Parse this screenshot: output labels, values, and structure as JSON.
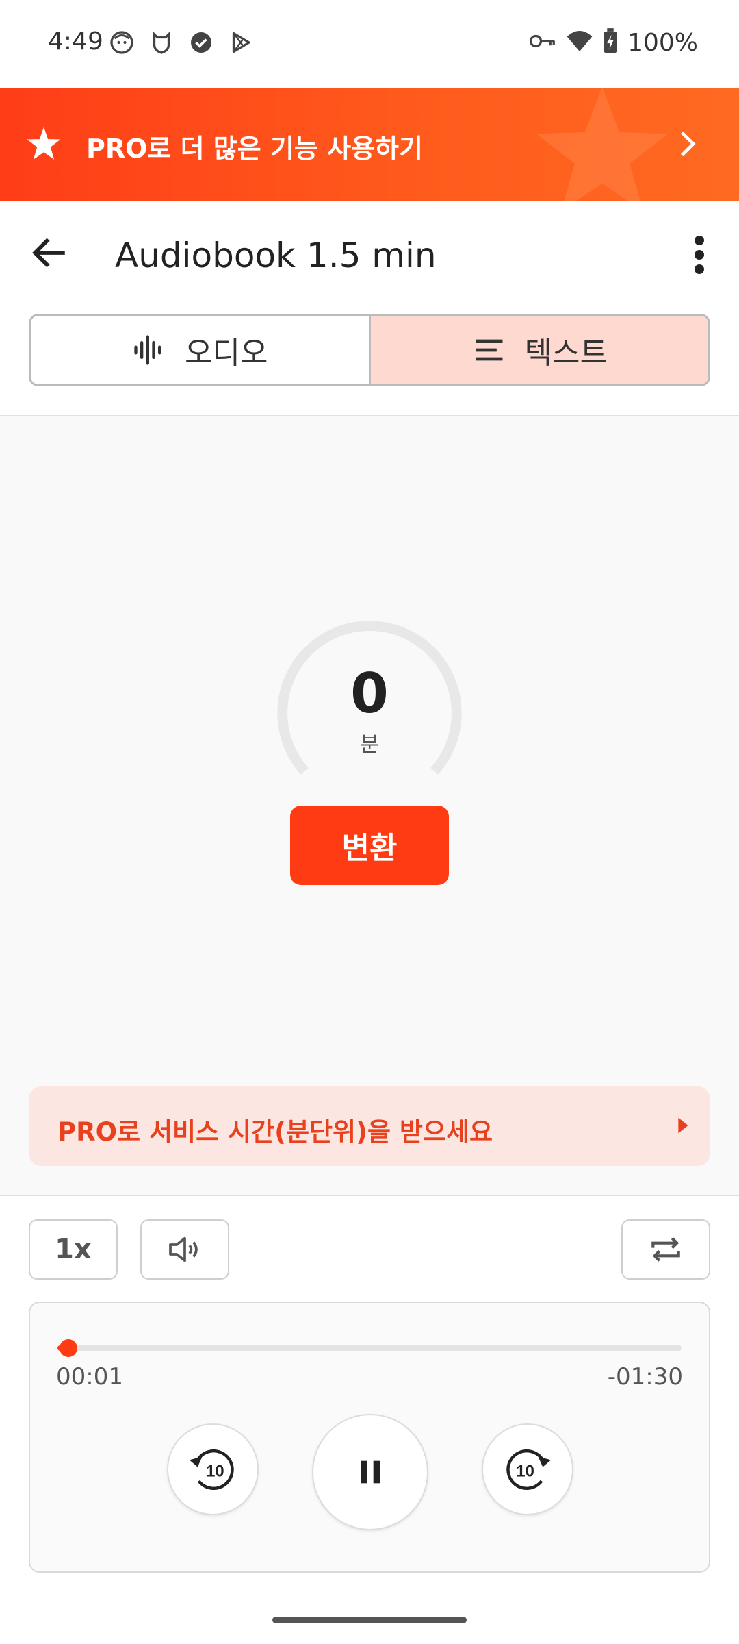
{
  "status_bar": {
    "time": "4:49",
    "battery": "100%",
    "icons_left": [
      "face-icon",
      "shield-cat-icon",
      "badge-check-icon",
      "play-store-icon"
    ],
    "icons_right": [
      "key-icon",
      "wifi-icon",
      "battery-charging-icon"
    ]
  },
  "promo": {
    "text": "PRO로 더 많은 기능 사용하기",
    "star_icon": "star-icon",
    "chevron_icon": "chevron-right-icon"
  },
  "appbar": {
    "title": "Audiobook 1.5 min",
    "back_icon": "arrow-back-icon",
    "more_icon": "more-vert-icon"
  },
  "tabs": [
    {
      "label": "오디오",
      "icon": "waveform-icon",
      "active": false
    },
    {
      "label": "텍스트",
      "icon": "text-lines-icon",
      "active": true
    }
  ],
  "gauge": {
    "value": "0",
    "unit": "분"
  },
  "convert_button": {
    "label": "변환"
  },
  "pro_service": {
    "text": "PRO로 서비스 시간(분단위)을 받으세요",
    "arrow_icon": "triangle-right-icon"
  },
  "controls": {
    "speed_label": "1x",
    "volume_icon": "volume-icon",
    "repeat_icon": "repeat-icon"
  },
  "player": {
    "current_time": "00:01",
    "remaining_time": "-01:30",
    "progress_fraction": 0.017,
    "rewind_label": "10",
    "forward_label": "10",
    "play_state_icon": "pause-icon"
  },
  "colors": {
    "accent": "#ff3b14",
    "promo_start": "#ff3d17",
    "promo_end": "#ff6a22",
    "tab_active_bg": "#fdd9cf",
    "pro_service_bg": "#fbe6e2",
    "pro_service_text": "#e9411d"
  }
}
